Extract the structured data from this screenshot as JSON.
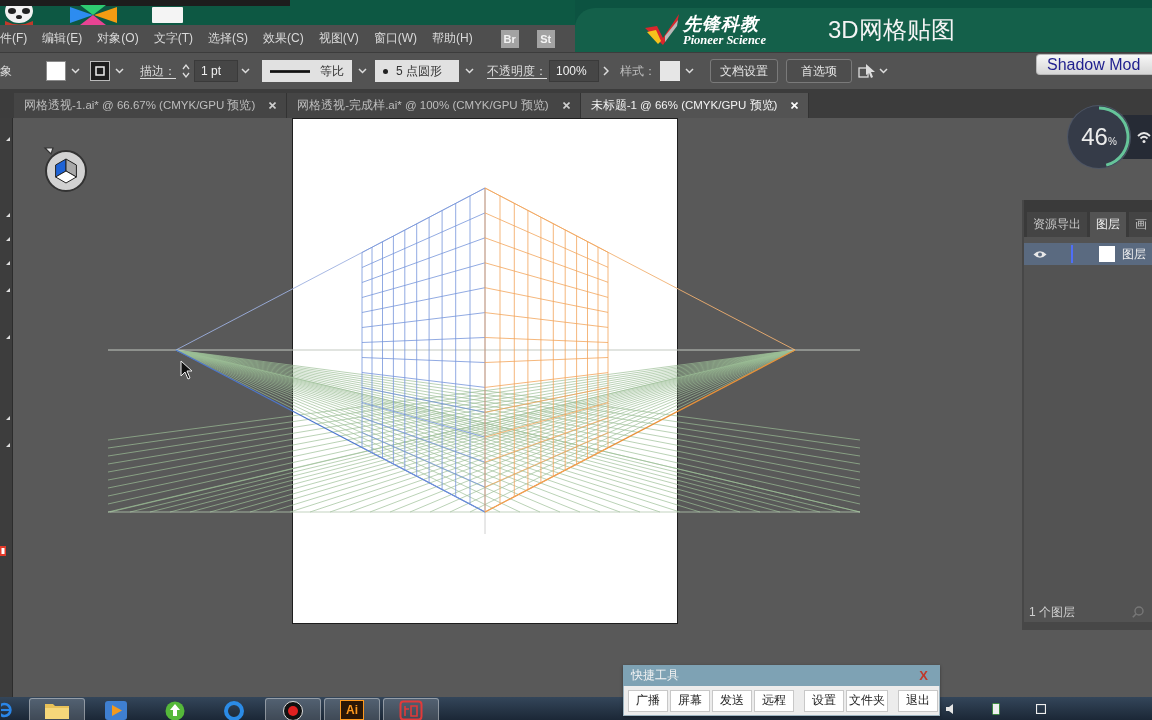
{
  "menu_bar": {
    "items": [
      "件(F)",
      "编辑(E)",
      "对象(O)",
      "文字(T)",
      "选择(S)",
      "效果(C)",
      "视图(V)",
      "窗口(W)",
      "帮助(H)"
    ],
    "apps": [
      "Br",
      "St"
    ]
  },
  "banner": {
    "brand": "先锋科教",
    "brand_en": "Pioneer Science",
    "title": "3D网格贴图"
  },
  "control_bar": {
    "selection": "象",
    "stroke_label": "描边：",
    "stroke_weight": "1 pt",
    "stroke_profile": "等比",
    "brush": "5 点圆形",
    "opacity_label": "不透明度：",
    "opacity": "100%",
    "style_label": "样式：",
    "buttons": [
      "文档设置",
      "首选项"
    ]
  },
  "shadow_mode": {
    "label": "Shadow Mod"
  },
  "tabs": [
    {
      "label": "网格透视-1.ai* @ 66.67% (CMYK/GPU 预览)",
      "selected": false
    },
    {
      "label": "网格透视-完成样.ai* @ 100% (CMYK/GPU 预览)",
      "selected": false
    },
    {
      "label": "未标题-1 @ 66% (CMYK/GPU 预览)",
      "selected": true
    }
  ],
  "speed_gauge": {
    "value": "46",
    "unit": "%",
    "level": 0.46
  },
  "layers_panel": {
    "tabs": [
      {
        "label": "资源导出",
        "selected": false
      },
      {
        "label": "图层",
        "selected": true
      },
      {
        "label": "画",
        "selected": false
      }
    ],
    "layers": [
      {
        "name": "图层",
        "selected": true,
        "visible": true,
        "color": "#4f6ef7"
      }
    ],
    "footer": "1 个图层"
  },
  "quick_tools": {
    "title": "快捷工具",
    "close": "X",
    "groups": [
      [
        "广播",
        "屏幕",
        "发送",
        "远程"
      ],
      [
        "设置",
        "文件夹"
      ],
      [
        "退出"
      ]
    ]
  },
  "taskbar": {
    "apps": [
      {
        "kind": "browser",
        "open": false
      },
      {
        "kind": "folder",
        "open": true
      },
      {
        "kind": "player",
        "open": false
      },
      {
        "kind": "update",
        "open": false
      },
      {
        "kind": "ring",
        "open": false
      },
      {
        "kind": "record",
        "open": true
      },
      {
        "kind": "ai",
        "label": "Ai",
        "open": true
      },
      {
        "kind": "seal",
        "open": true
      }
    ]
  }
}
